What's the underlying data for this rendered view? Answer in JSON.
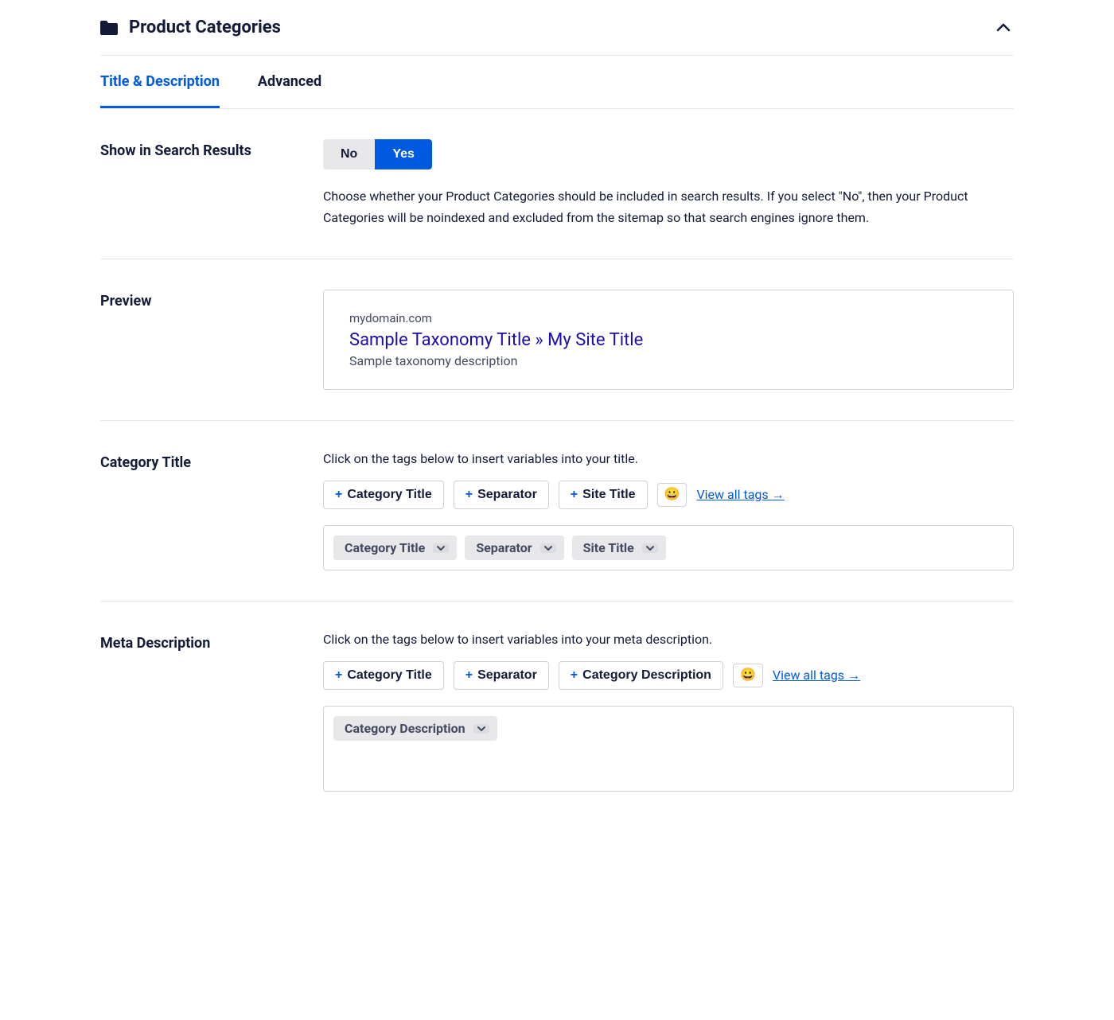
{
  "header": {
    "title": "Product Categories"
  },
  "tabs": {
    "title_desc": "Title & Description",
    "advanced": "Advanced"
  },
  "search_results": {
    "label": "Show in Search Results",
    "no": "No",
    "yes": "Yes",
    "help": "Choose whether your Product Categories should be included in search results. If you select \"No\", then your Product Categories will be noindexed and excluded from the sitemap so that search engines ignore them."
  },
  "preview": {
    "label": "Preview",
    "domain": "mydomain.com",
    "title": "Sample Taxonomy Title » My Site Title",
    "desc": "Sample taxonomy description"
  },
  "category_title": {
    "label": "Category Title",
    "hint": "Click on the tags below to insert variables into your title.",
    "tags": {
      "category_title": "Category Title",
      "separator": "Separator",
      "site_title": "Site Title"
    },
    "view_all": "View all tags →",
    "tokens": {
      "category_title": "Category Title",
      "separator": "Separator",
      "site_title": "Site Title"
    }
  },
  "meta_desc": {
    "label": "Meta Description",
    "hint": "Click on the tags below to insert variables into your meta description.",
    "tags": {
      "category_title": "Category Title",
      "separator": "Separator",
      "category_desc": "Category Description"
    },
    "view_all": "View all tags →",
    "tokens": {
      "category_desc": "Category Description"
    }
  }
}
